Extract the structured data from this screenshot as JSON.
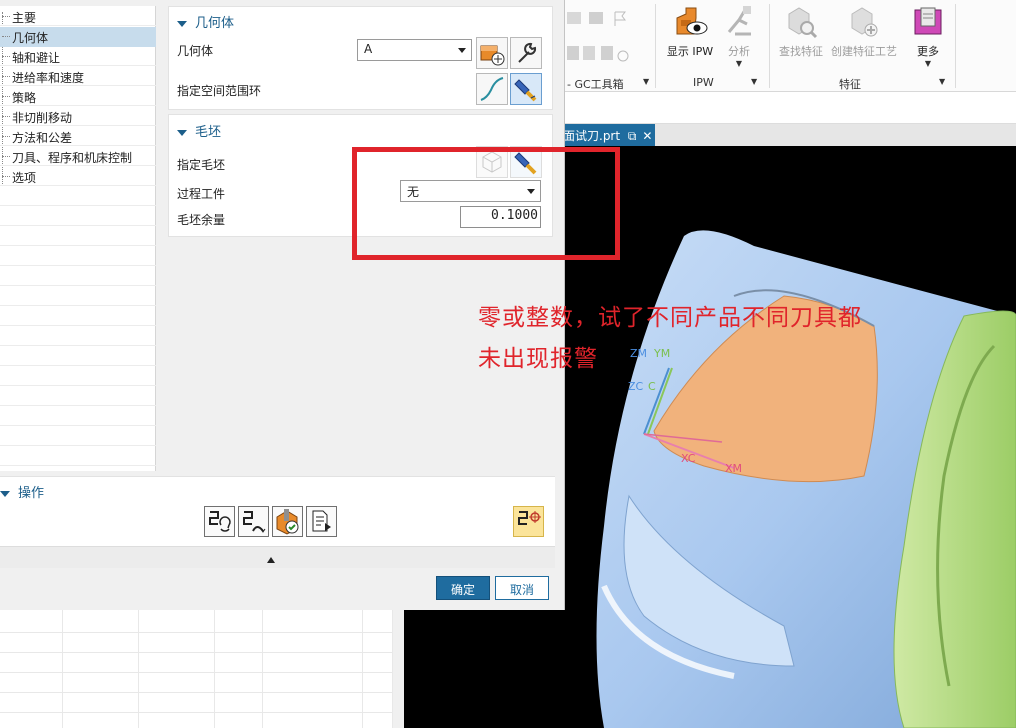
{
  "ribbon": {
    "groups": [
      {
        "label": "- GC工具箱"
      },
      {
        "label": "IPW"
      },
      {
        "label": "特征"
      }
    ],
    "buttons": [
      {
        "label": "显示 IPW",
        "icon": "display-ipw-icon",
        "enabled": true
      },
      {
        "label": "分析",
        "icon": "analysis-icon",
        "enabled": false
      },
      {
        "label": "查找特征",
        "icon": "find-feature-icon",
        "enabled": false
      },
      {
        "label": "创建特征工艺",
        "icon": "create-feature-process-icon",
        "enabled": false
      },
      {
        "label": "更多",
        "icon": "more-icon",
        "enabled": true
      }
    ]
  },
  "document_tab": {
    "title": "面试刀.prt"
  },
  "dialog": {
    "tree": [
      {
        "label": "主要",
        "selected": false
      },
      {
        "label": "几何体",
        "selected": true
      },
      {
        "label": "轴和避让",
        "selected": false
      },
      {
        "label": "进给率和速度",
        "selected": false
      },
      {
        "label": "策略",
        "selected": false
      },
      {
        "label": "非切削移动",
        "selected": false
      },
      {
        "label": "方法和公差",
        "selected": false
      },
      {
        "label": "刀具、程序和机床控制",
        "selected": false
      },
      {
        "label": "选项",
        "selected": false
      }
    ],
    "geometry_section": {
      "title": "几何体",
      "geometry_label": "几何体",
      "geometry_value": "A",
      "space_range_label": "指定空间范围环"
    },
    "blank_section": {
      "title": "毛坯",
      "specify_blank_label": "指定毛坯",
      "ipw_label": "过程工件",
      "ipw_value": "无",
      "stock_label": "毛坯余量",
      "stock_value": "0.1000"
    },
    "operations": {
      "title": "操作"
    },
    "ok_label": "确定",
    "cancel_label": "取消"
  },
  "viewport": {
    "axes": {
      "zm": "ZM",
      "ym": "YM",
      "zc": "ZC",
      "c": "C",
      "xc": "XC",
      "xm": "XM"
    }
  },
  "annotation": {
    "line1": "零或整数，试了不同产品不同刀具都",
    "line2": "未出现报警"
  },
  "colors": {
    "accent": "#1f6c9f",
    "annotation": "#e0242b",
    "part_blue": "#a6c8f2",
    "part_green": "#b9e08a",
    "part_orange": "#f1b27c"
  }
}
